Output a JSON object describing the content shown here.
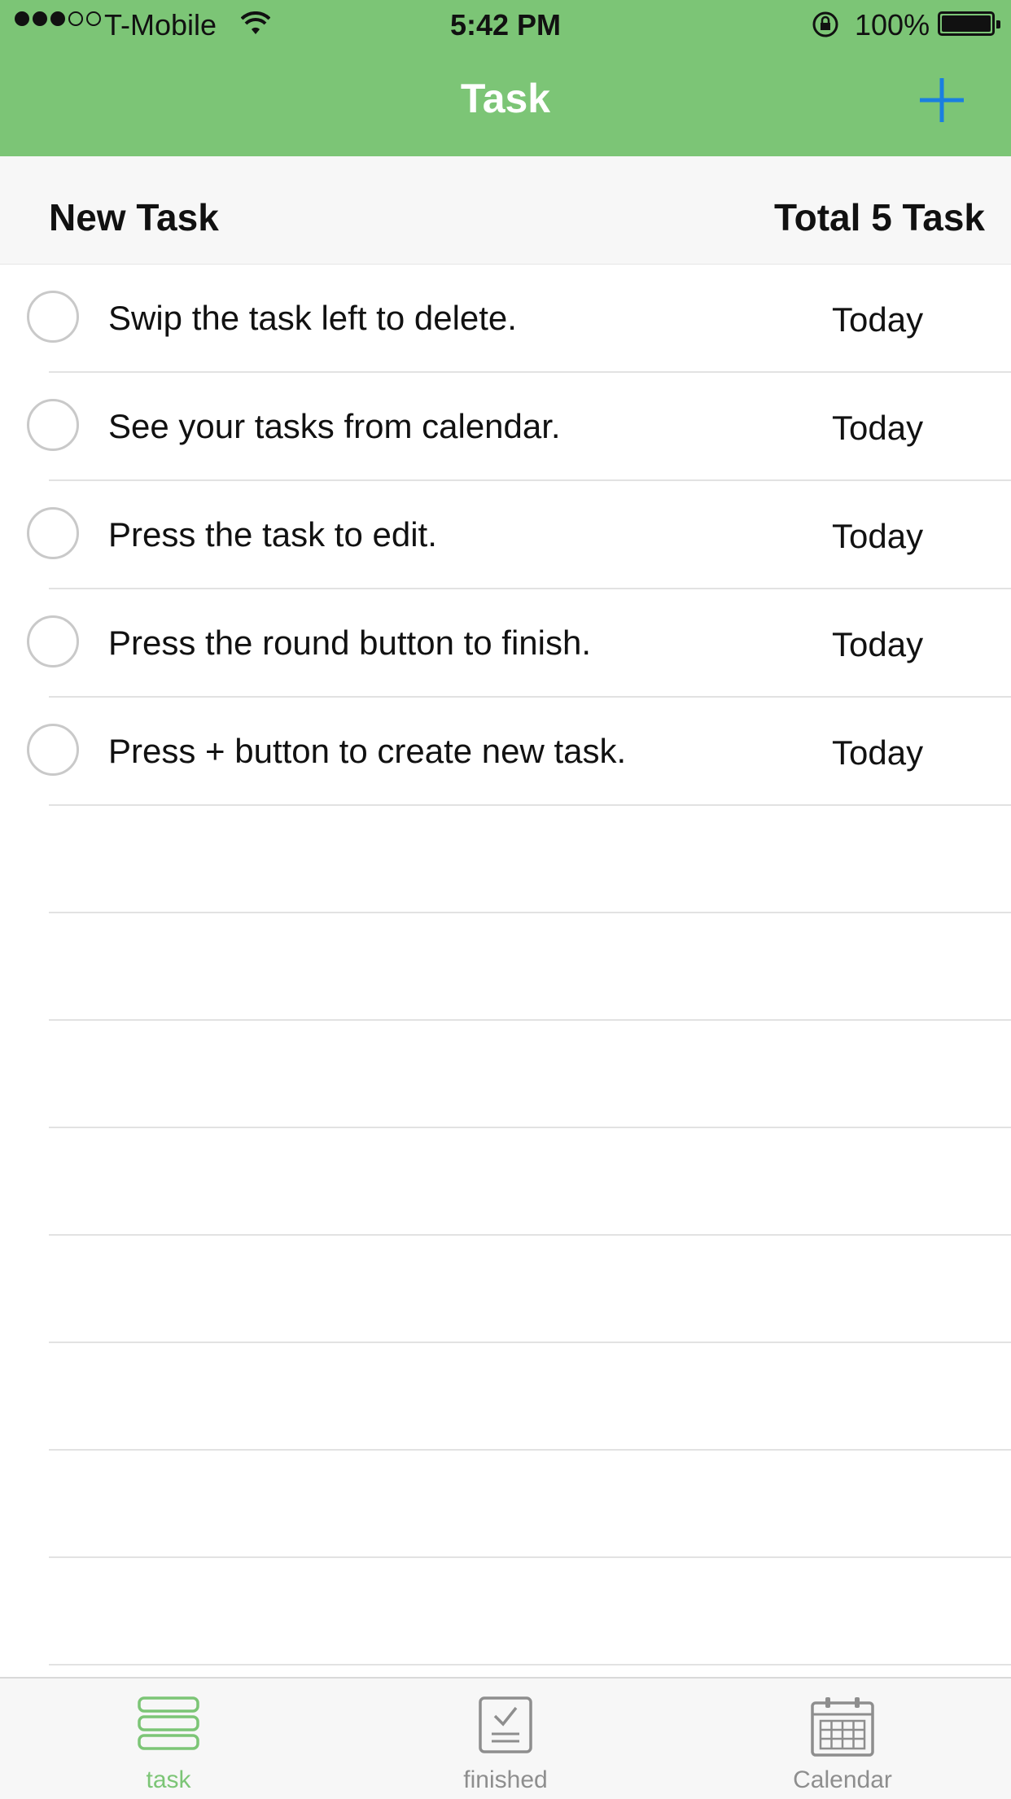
{
  "status_bar": {
    "carrier": "T-Mobile",
    "time": "5:42 PM",
    "battery": "100%",
    "signal_bars_filled": 3,
    "signal_bars_total": 5
  },
  "nav": {
    "title": "Task",
    "add_icon": "plus-icon",
    "accent_color": "#7cc576",
    "add_color": "#1a7fe0"
  },
  "section": {
    "left": "New Task",
    "right": "Total 5 Task"
  },
  "tasks": [
    {
      "title": "Swip the task left to delete.",
      "date": "Today"
    },
    {
      "title": "See your tasks from calendar.",
      "date": "Today"
    },
    {
      "title": "Press the task to edit.",
      "date": "Today"
    },
    {
      "title": "Press the round button to finish.",
      "date": "Today"
    },
    {
      "title": "Press + button to create new task.",
      "date": "Today"
    }
  ],
  "tabs": [
    {
      "label": "task",
      "icon": "task-list-icon",
      "active": true
    },
    {
      "label": "finished",
      "icon": "finished-checklist-icon",
      "active": false
    },
    {
      "label": "Calendar",
      "icon": "calendar-icon",
      "active": false
    }
  ]
}
